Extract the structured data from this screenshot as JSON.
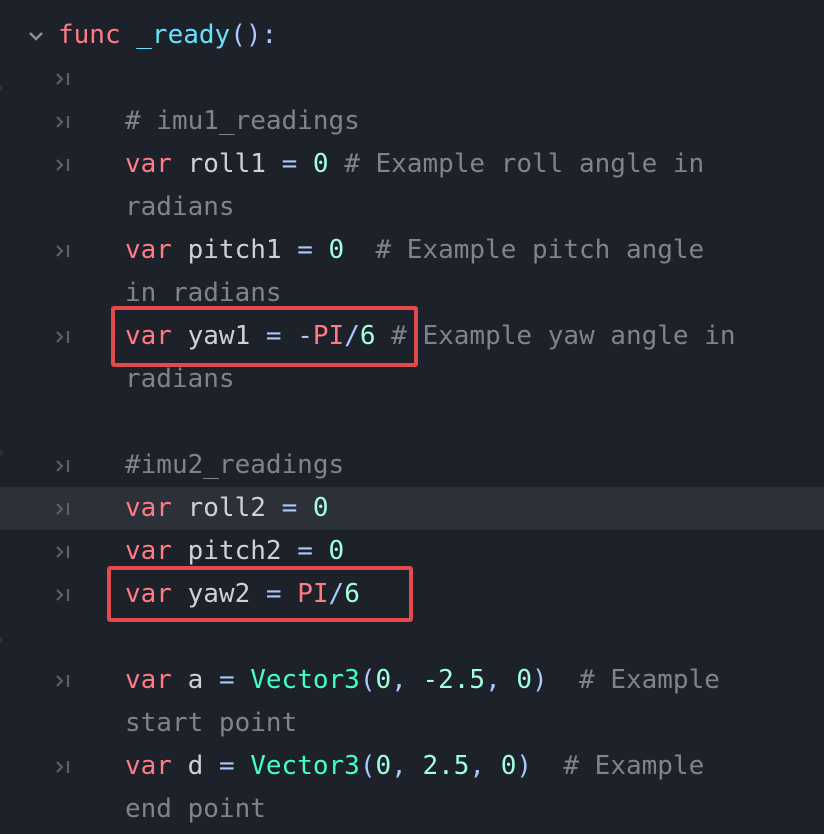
{
  "editor": {
    "func_line": {
      "keyword": "func",
      "name": "_ready",
      "paren": "():"
    },
    "comment_imu1": "# imu1_readings",
    "roll1": {
      "kw": "var",
      "name": "roll1",
      "eq": "=",
      "val": "0",
      "comment": "# Example roll angle in",
      "wrap": "radians"
    },
    "pitch1": {
      "kw": "var",
      "name": "pitch1",
      "eq": "=",
      "val": "0",
      "comment": "# Example pitch angle",
      "wrap": "in radians"
    },
    "yaw1": {
      "kw": "var",
      "name": "yaw1",
      "eq": "=",
      "minus": "-",
      "pi": "PI",
      "slash": "/",
      "six": "6",
      "comment": "# Example yaw angle in",
      "wrap": "radians"
    },
    "comment_imu2": "#imu2_readings",
    "roll2": {
      "kw": "var",
      "name": "roll2",
      "eq": "=",
      "val": "0"
    },
    "pitch2": {
      "kw": "var",
      "name": "pitch2",
      "eq": "=",
      "val": "0"
    },
    "yaw2": {
      "kw": "var",
      "name": "yaw2",
      "eq": "=",
      "pi": "PI",
      "slash": "/",
      "six": "6"
    },
    "a": {
      "kw": "var",
      "name": "a",
      "eq": "=",
      "cls": "Vector3",
      "open": "(",
      "x": "0",
      "c1": ",",
      "y": "-2.5",
      "c2": ",",
      "z": "0",
      "close": ")",
      "comment": "# Example",
      "wrap": "start point"
    },
    "d": {
      "kw": "var",
      "name": "d",
      "eq": "=",
      "cls": "Vector3",
      "open": "(",
      "x": "0",
      "c1": ",",
      "y": "2.5",
      "c2": ",",
      "z": "0",
      "close": ")",
      "comment": "# Example",
      "wrap": "end point"
    }
  },
  "colors": {
    "background": "#1d2129",
    "current_line": "#2c3038",
    "keyword": "#ff7b85",
    "function": "#66e2ff",
    "class": "#42ffc2",
    "number": "#a1ffe0",
    "comment": "#80838b",
    "highlight_box": "#e24b4b"
  },
  "icons": {
    "fold": "chevron-down-icon",
    "indent": "tab-indent-icon"
  }
}
